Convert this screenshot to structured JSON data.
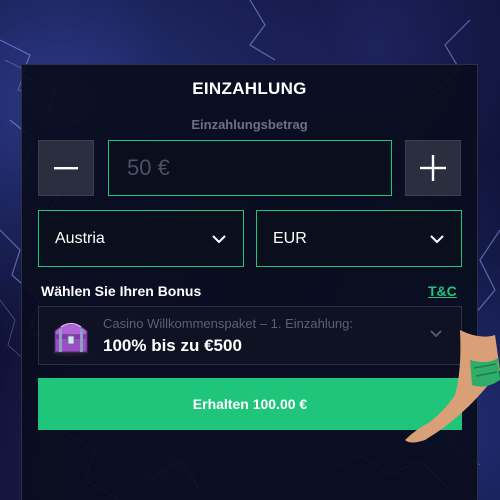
{
  "deposit": {
    "title": "EINZAHLUNG",
    "amount_label": "Einzahlungsbetrag",
    "amount_placeholder": "50 €",
    "minus_icon": "minus-icon",
    "plus_icon": "plus-icon"
  },
  "selects": {
    "country": {
      "value": "Austria",
      "icon": "chevron-down-icon"
    },
    "currency": {
      "value": "EUR",
      "icon": "chevron-down-icon"
    }
  },
  "bonus": {
    "label": "Wählen Sie Ihren Bonus",
    "tc_link": "T&C",
    "description": "Casino Willkommenspaket – 1. Einzahlung:",
    "amount": "100% bis zu €500",
    "icon": "treasure-chest-icon"
  },
  "submit": {
    "label": "Erhalten 100.00 €"
  },
  "colors": {
    "accent": "#1fc57a",
    "panel": "#0a0d1e",
    "button_gray": "#2a2e3e",
    "background": "#0c0f2e"
  }
}
